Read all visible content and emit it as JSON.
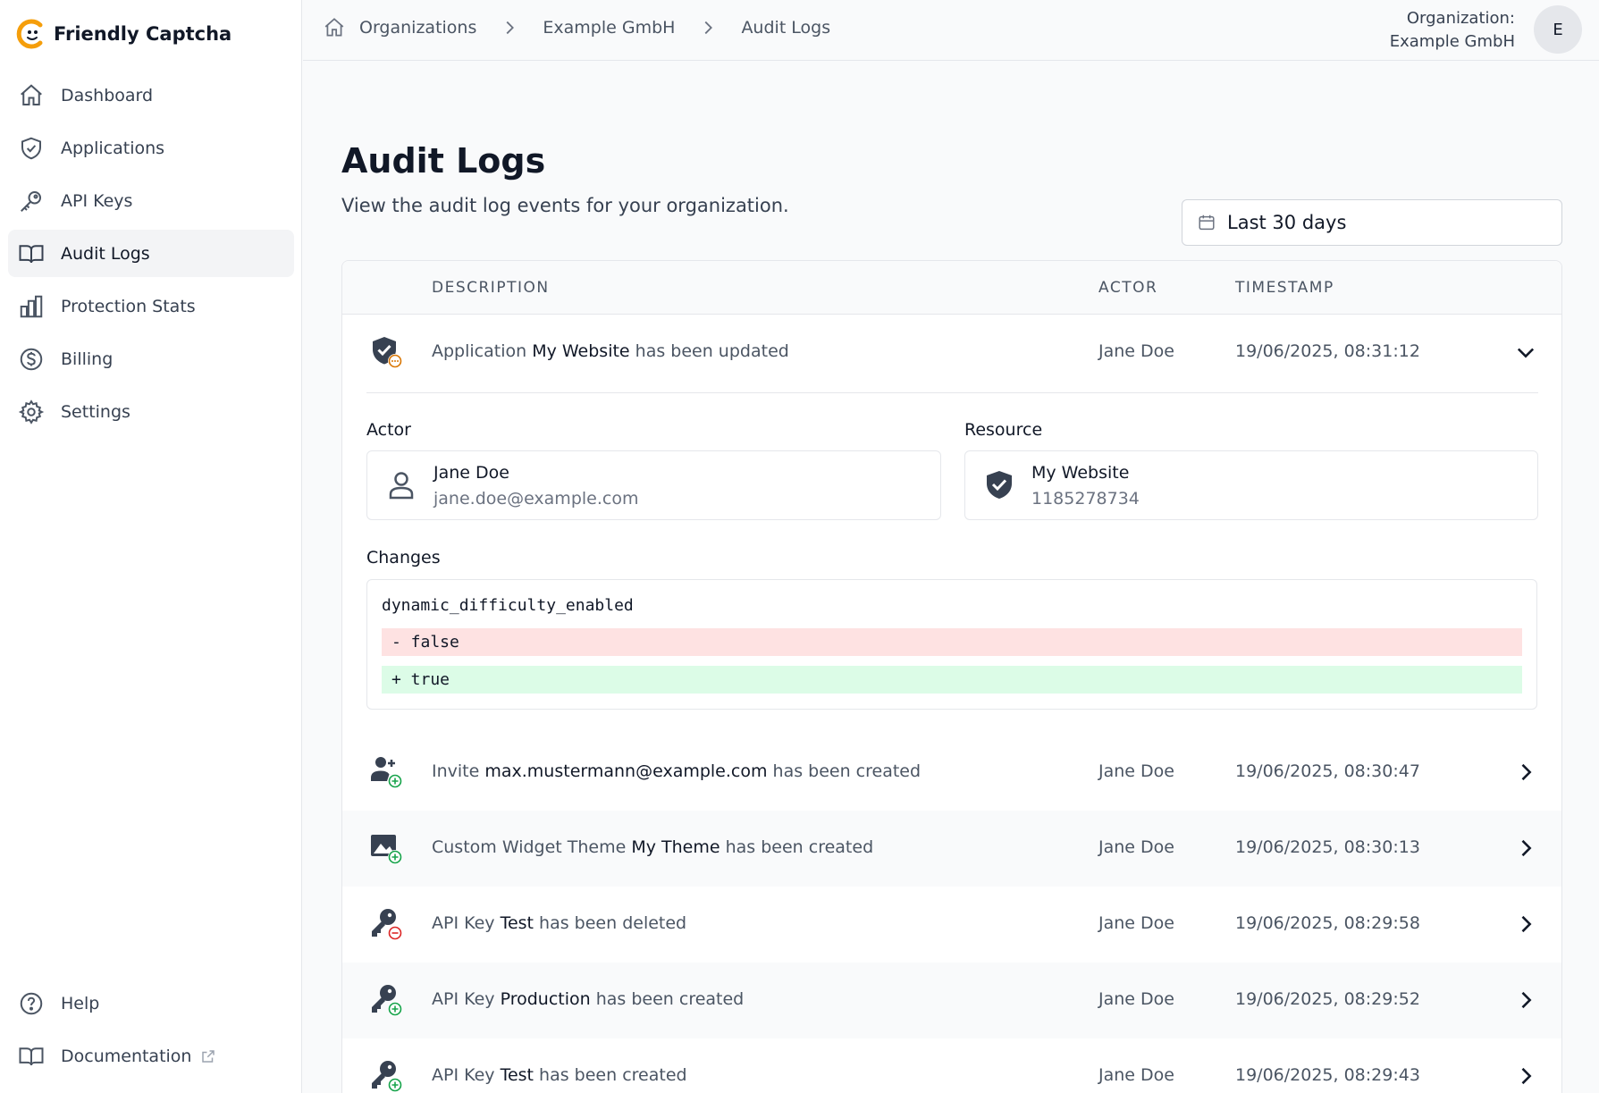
{
  "brand": {
    "name": "Friendly Captcha",
    "accent": "#f59e0b"
  },
  "sidebar": {
    "items": [
      {
        "label": "Dashboard",
        "icon": "home-icon"
      },
      {
        "label": "Applications",
        "icon": "shield-check-icon"
      },
      {
        "label": "API Keys",
        "icon": "key-icon"
      },
      {
        "label": "Audit Logs",
        "icon": "book-icon",
        "active": true
      },
      {
        "label": "Protection Stats",
        "icon": "bar-chart-icon"
      },
      {
        "label": "Billing",
        "icon": "dollar-icon"
      },
      {
        "label": "Settings",
        "icon": "gear-icon"
      }
    ],
    "bottom": [
      {
        "label": "Help",
        "icon": "question-icon"
      },
      {
        "label": "Documentation",
        "icon": "book-icon"
      }
    ]
  },
  "breadcrumb": [
    "Organizations",
    "Example GmbH",
    "Audit Logs"
  ],
  "org": {
    "label": "Organization:",
    "name": "Example GmbH",
    "avatar": "E"
  },
  "page": {
    "title": "Audit Logs",
    "subtitle": "View the audit log events for your organization.",
    "date_range": "Last 30 days"
  },
  "table": {
    "headers": {
      "description": "DESCRIPTION",
      "actor": "ACTOR",
      "timestamp": "TIMESTAMP"
    },
    "rows": [
      {
        "pre": "Application ",
        "bold": "My Website",
        "post": " has been updated",
        "actor": "Jane Doe",
        "timestamp": "19/06/2025, 08:31:12",
        "icon": "shield-updated-icon",
        "expanded": true
      },
      {
        "pre": "Invite ",
        "bold": "max.mustermann@example.com",
        "post": " has been created",
        "actor": "Jane Doe",
        "timestamp": "19/06/2025, 08:30:47",
        "icon": "user-plus-icon"
      },
      {
        "pre": "Custom Widget Theme ",
        "bold": "My Theme",
        "post": " has been created",
        "actor": "Jane Doe",
        "timestamp": "19/06/2025, 08:30:13",
        "icon": "image-plus-icon"
      },
      {
        "pre": "API Key ",
        "bold": "Test",
        "post": " has been deleted",
        "actor": "Jane Doe",
        "timestamp": "19/06/2025, 08:29:58",
        "icon": "key-minus-icon"
      },
      {
        "pre": "API Key ",
        "bold": "Production",
        "post": " has been created",
        "actor": "Jane Doe",
        "timestamp": "19/06/2025, 08:29:52",
        "icon": "key-plus-icon"
      },
      {
        "pre": "API Key ",
        "bold": "Test",
        "post": " has been created",
        "actor": "Jane Doe",
        "timestamp": "19/06/2025, 08:29:43",
        "icon": "key-plus-icon"
      }
    ]
  },
  "detail": {
    "actor_label": "Actor",
    "actor_name": "Jane Doe",
    "actor_email": "jane.doe@example.com",
    "resource_label": "Resource",
    "resource_name": "My Website",
    "resource_id": "1185278734",
    "changes_label": "Changes",
    "field": "dynamic_difficulty_enabled",
    "removed": "- false",
    "added": "+ true"
  },
  "colors": {
    "added": "#16a34a",
    "removed": "#dc2626",
    "updated": "#d97706"
  }
}
